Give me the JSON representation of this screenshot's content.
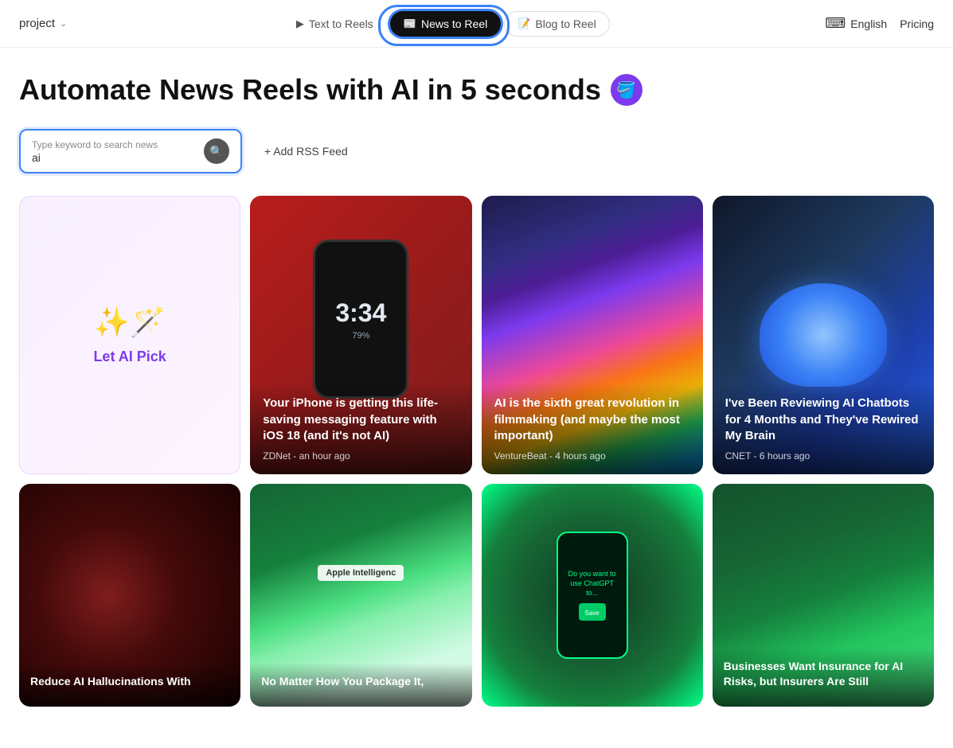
{
  "navbar": {
    "project_label": "project",
    "tabs": [
      {
        "id": "text-to-reel",
        "label": "Text to Reels",
        "icon": "▶",
        "active": false
      },
      {
        "id": "news-to-reel",
        "label": "News to Reel",
        "icon": "📰",
        "active": true
      },
      {
        "id": "blog-to-reel",
        "label": "Blog to Reel",
        "icon": "📝",
        "active": false
      }
    ],
    "lang_icon": "A",
    "lang_label": "English",
    "pricing_label": "Pricing"
  },
  "main": {
    "title": "Automate News Reels with AI in 5 seconds",
    "title_emoji": "🪣",
    "search": {
      "placeholder": "Type keyword to search news",
      "value": "ai",
      "button_icon": "🔍"
    },
    "rss_label": "+ Add RSS Feed"
  },
  "news_cards": [
    {
      "id": "ai-pick",
      "type": "ai-pick",
      "label": "Let AI Pick"
    },
    {
      "id": "iphone-ios18",
      "type": "image",
      "bg": "red",
      "title": "Your iPhone is getting this life-saving messaging feature with iOS 18 (and it's not AI)",
      "source": "ZDNet",
      "time": "an hour ago"
    },
    {
      "id": "ai-filmmaking",
      "type": "image",
      "bg": "laser",
      "title": "AI is the sixth great revolution in filmmaking (and maybe the most important)",
      "source": "VentureBeat",
      "time": "4 hours ago"
    },
    {
      "id": "ai-chatbots-brain",
      "type": "image",
      "bg": "brain",
      "title": "I've Been Reviewing AI Chatbots for 4 Months and They've Rewired My Brain",
      "source": "CNET",
      "time": "6 hours ago"
    }
  ],
  "news_cards_row2": [
    {
      "id": "ai-hallucinations",
      "type": "image",
      "bg": "statue",
      "title": "Reduce AI Hallucinations With",
      "source": "",
      "time": ""
    },
    {
      "id": "apple-intelligence",
      "type": "image",
      "bg": "apple-event",
      "title": "No Matter How You Package It,",
      "source": "",
      "time": ""
    },
    {
      "id": "chatgpt-phone",
      "type": "image",
      "bg": "green-phone",
      "title": "",
      "source": "",
      "time": ""
    },
    {
      "id": "ai-insurance",
      "type": "image",
      "bg": "money",
      "title": "Businesses Want Insurance for AI Risks, but Insurers Are Still",
      "source": "",
      "time": ""
    }
  ]
}
